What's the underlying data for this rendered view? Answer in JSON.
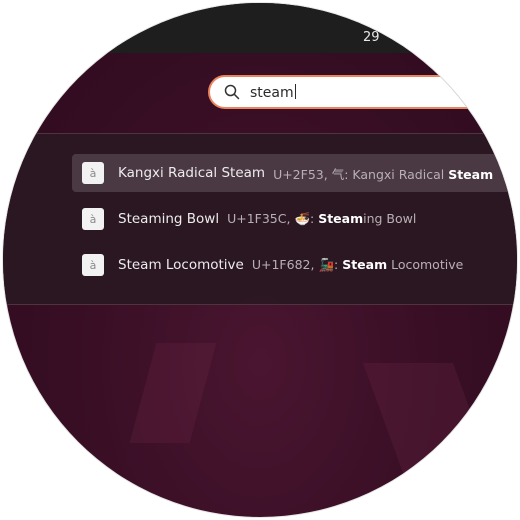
{
  "top_bar": {
    "clock_text": "29"
  },
  "search": {
    "value": "steam"
  },
  "results": [
    {
      "title": "Kangxi Radical Steam",
      "code": "U+2F53",
      "glyph": "⽓",
      "pre": ": Kangxi Radical ",
      "bold": "Steam",
      "post": ""
    },
    {
      "title": "Steaming Bowl",
      "code": "U+1F35C",
      "glyph": "🍜",
      "pre": ": ",
      "bold": "Steam",
      "post": "ing Bowl"
    },
    {
      "title": "Steam Locomotive",
      "code": "U+1F682",
      "glyph": "🚂",
      "pre": ": ",
      "bold": "Steam",
      "post": " Locomotive"
    }
  ],
  "colors": {
    "accent": "#e9845f",
    "wallpaper": "#3a0f26",
    "panel": "#2b1822",
    "top_bar": "#1e1e1e"
  },
  "icons": {
    "search": "search-icon",
    "app": "character-app-icon"
  },
  "app_icon_glyph": "à"
}
